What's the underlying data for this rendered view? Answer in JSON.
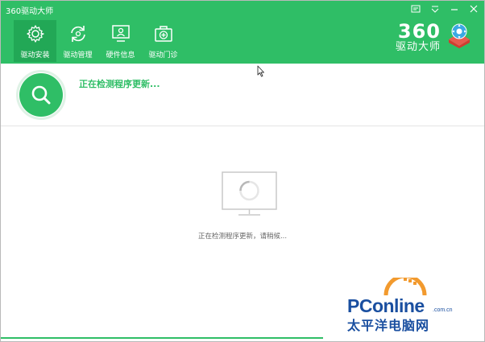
{
  "window": {
    "title": "360驱动大师"
  },
  "nav": {
    "items": [
      {
        "label": "驱动安装",
        "icon": "gear-icon",
        "active": true
      },
      {
        "label": "驱动管理",
        "icon": "refresh-icon",
        "active": false
      },
      {
        "label": "硬件信息",
        "icon": "monitor-user-icon",
        "active": false
      },
      {
        "label": "驱动门诊",
        "icon": "medical-kit-icon",
        "active": false
      }
    ]
  },
  "brand": {
    "number": "360",
    "name": "驱动大师"
  },
  "status": {
    "text": "正在检测程序更新..."
  },
  "main": {
    "message": "正在检测程序更新，请稍候..."
  },
  "watermark": {
    "brand": "PConline",
    "domain": ".com.cn",
    "cn": "太平洋电脑网"
  },
  "colors": {
    "accent": "#2fbe66",
    "accent_dark": "#22a856",
    "watermark_blue": "#1a4fa0",
    "watermark_orange": "#f29a2e"
  }
}
